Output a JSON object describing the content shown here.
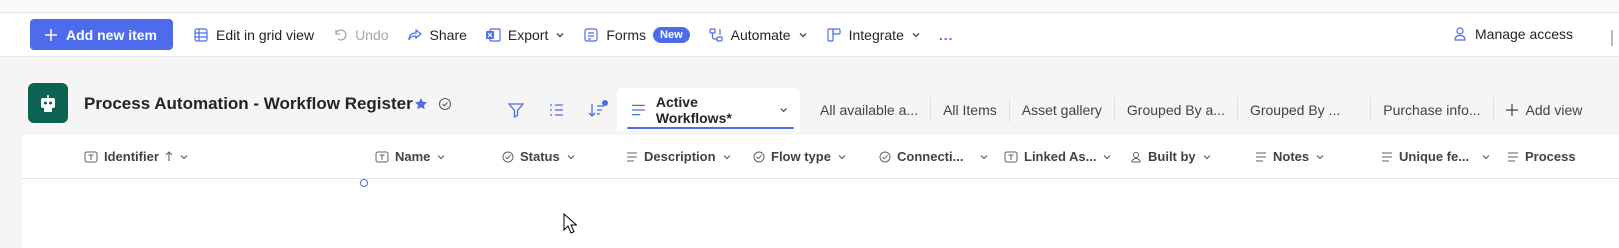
{
  "command_bar": {
    "add_new_item": "Add new item",
    "edit_grid": "Edit in grid view",
    "undo": "Undo",
    "share": "Share",
    "export": "Export",
    "forms": "Forms",
    "forms_badge": "New",
    "automate": "Automate",
    "integrate": "Integrate",
    "more": "...",
    "manage_access": "Manage access"
  },
  "list": {
    "title": "Process Automation - Workflow Register"
  },
  "views": {
    "active": "Active Workflows*",
    "tabs": [
      "All available a...",
      "All Items",
      "Asset gallery",
      "Grouped By a...",
      "Grouped By ...",
      "Purchase info..."
    ],
    "add_view": "Add view"
  },
  "columns": [
    {
      "label": "Identifier",
      "icon": "text-field-icon"
    },
    {
      "label": "Name",
      "icon": "text-field-icon"
    },
    {
      "label": "Status",
      "icon": "choice-icon"
    },
    {
      "label": "Description",
      "icon": "multiline-icon"
    },
    {
      "label": "Flow type",
      "icon": "choice-icon"
    },
    {
      "label": "Connecti...",
      "icon": "choice-icon"
    },
    {
      "label": "Linked As...",
      "icon": "text-field-icon"
    },
    {
      "label": "Built by",
      "icon": "person-icon"
    },
    {
      "label": "Notes",
      "icon": "multiline-icon"
    },
    {
      "label": "Unique fe...",
      "icon": "multiline-icon"
    },
    {
      "label": "Process",
      "icon": "multiline-icon"
    }
  ],
  "colors": {
    "accent": "#4f6bed",
    "site_icon": "#0e6251"
  }
}
